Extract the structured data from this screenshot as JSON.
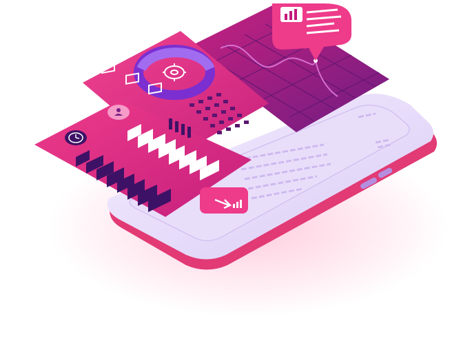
{
  "palette": {
    "pink": "#e8368f",
    "magenta": "#c2187a",
    "purple": "#7b1f86",
    "deep_purple": "#3d1266",
    "lavender": "#d9c9f2",
    "lavender_light": "#ece3fb",
    "phone_edge": "#e23a74",
    "white": "#ffffff"
  },
  "icons": [
    "gear-icon",
    "clock-icon",
    "user-icon",
    "bar-chart-icon",
    "arrow-right-icon",
    "monitor-arrow-icon"
  ]
}
